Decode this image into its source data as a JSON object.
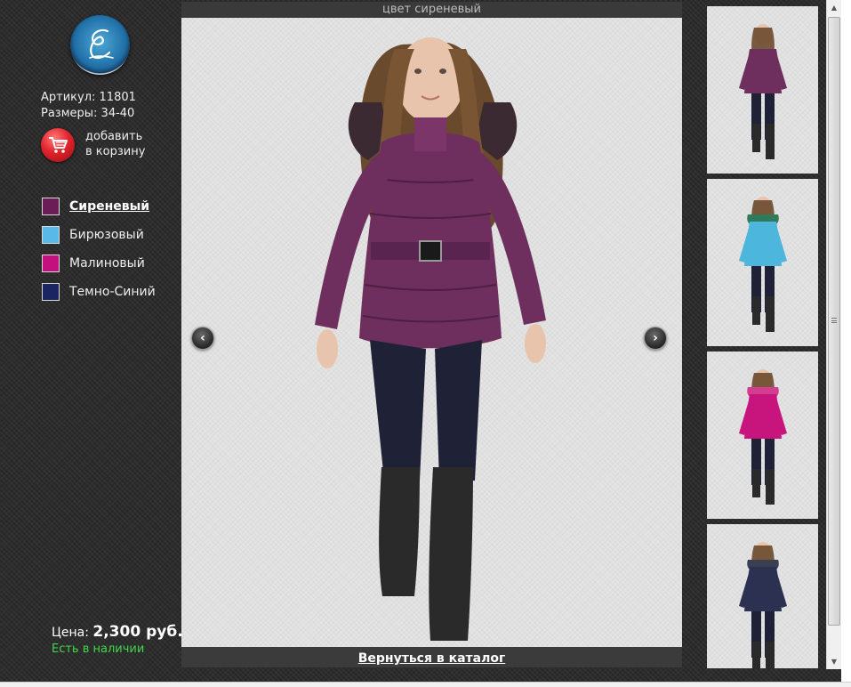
{
  "product": {
    "article": "Артикул: 11801",
    "sizes": "Размеры: 34-40",
    "cart_line1": "добавить",
    "cart_line2": "в корзину"
  },
  "colors": [
    {
      "label": "Сиреневый",
      "hex": "#6b1d58",
      "active": true
    },
    {
      "label": "Бирюзовый",
      "hex": "#59b9e8",
      "active": false
    },
    {
      "label": "Малиновый",
      "hex": "#c4107f",
      "active": false
    },
    {
      "label": "Темно-Синий",
      "hex": "#1a2561",
      "active": false
    }
  ],
  "price": {
    "label": "Цена:",
    "value": "2,300 руб.",
    "stock": "Есть в наличии"
  },
  "viewer": {
    "title": "цвет сиреневый",
    "back_link": "Вернуться в каталог",
    "prev_icon": "‹",
    "next_icon": "›"
  },
  "thumbnails": [
    {
      "color": "purple",
      "jacket_hex": "#6e2f5e"
    },
    {
      "color": "turquoise",
      "jacket_hex": "#4cb6dc"
    },
    {
      "color": "raspberry",
      "jacket_hex": "#c8157e"
    },
    {
      "color": "navy",
      "jacket_hex": "#2c3152"
    }
  ],
  "icons": {
    "logo": "logo-icon",
    "cart": "shopping-cart-icon",
    "prev": "chevron-left-icon",
    "next": "chevron-right-icon"
  },
  "accent_colors": {
    "stock_green": "#41d64a",
    "cart_red": "#e2242c",
    "background": "#2e2e2e"
  }
}
